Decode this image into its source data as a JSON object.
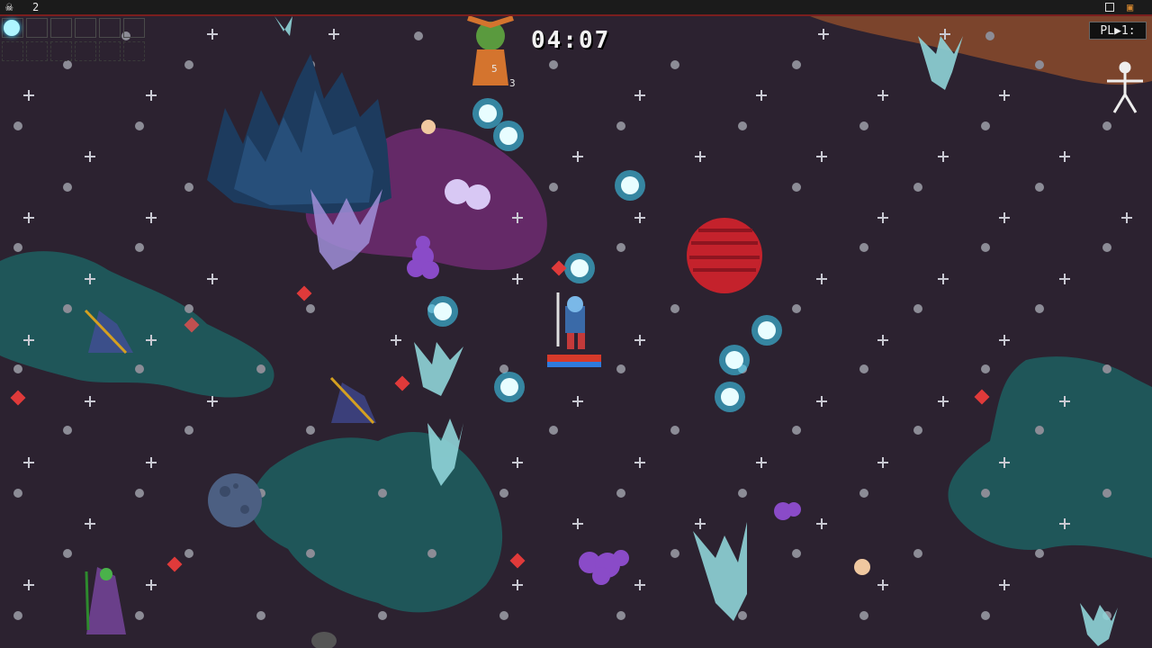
{
  "hud": {
    "kill_icon": "skull-icon",
    "kill_count": "2",
    "timer": "04:07",
    "replay_badge": "PL▶1:",
    "weapon_slots_filled": 1,
    "weapon_slots_total": 6
  },
  "damage_numbers": [
    "5",
    "3"
  ],
  "colors": {
    "background": "#2c2230",
    "orb": "#aef5ff",
    "orb_glow": "#3fd9ff",
    "hp_bar": "#d63a2a",
    "mp_bar": "#2f7bdc",
    "nebula_teal": "#1f5a5c",
    "nebula_purple": "#6a2a6e",
    "planet_red": "#c4222c",
    "planet_blue": "#4c5f82"
  }
}
